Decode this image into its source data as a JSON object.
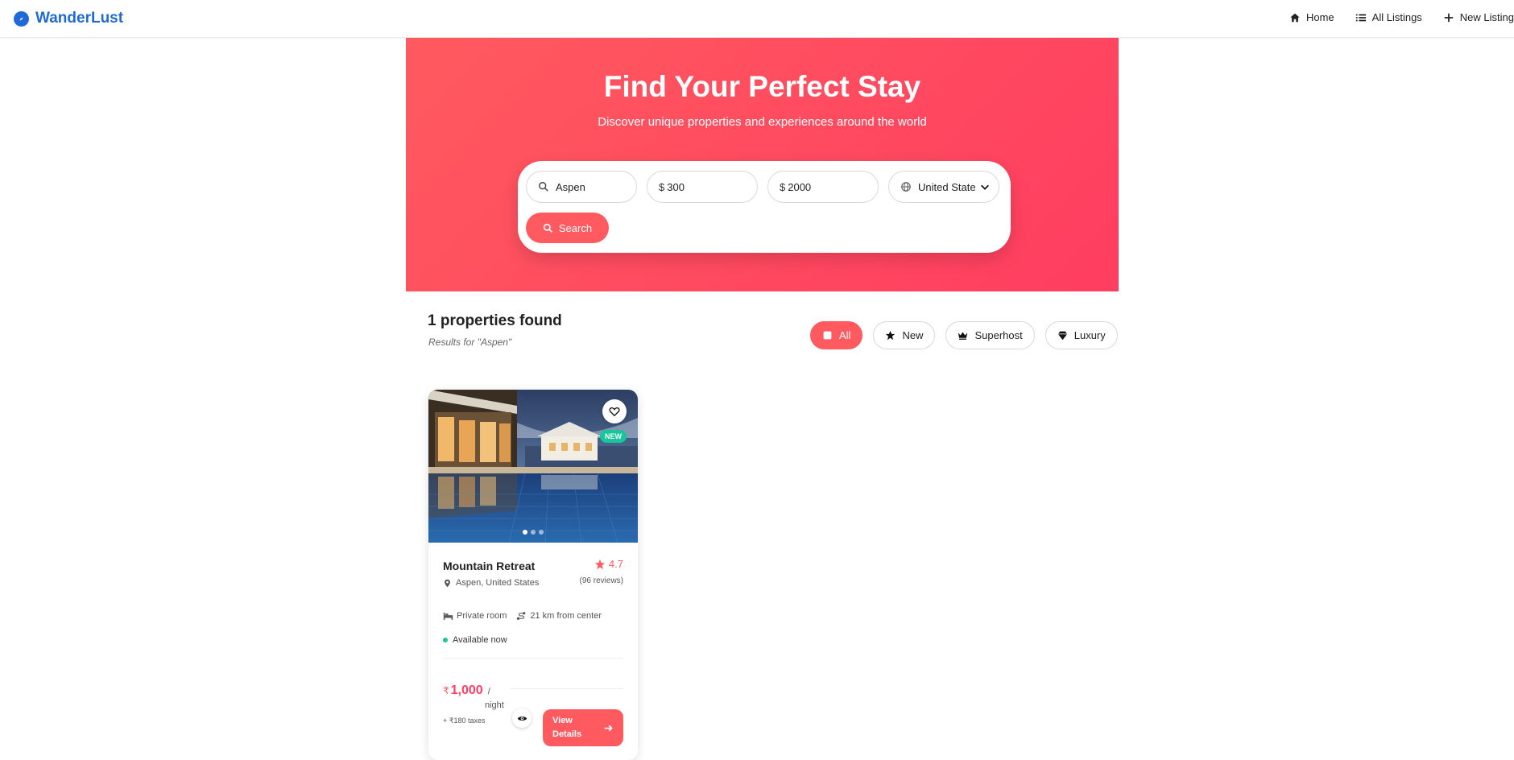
{
  "nav": {
    "brand": "WanderLust",
    "links": [
      {
        "label": "Home",
        "icon": "home-icon"
      },
      {
        "label": "All Listings",
        "icon": "list-icon"
      },
      {
        "label": "New Listing",
        "icon": "plus-icon"
      }
    ]
  },
  "hero": {
    "title": "Find Your Perfect Stay",
    "subtitle": "Discover unique properties and experiences around the world"
  },
  "search": {
    "location_value": "Aspen",
    "min_price_value": "300",
    "max_price_value": "2000",
    "currency_symbol": "$",
    "country_selected": "United State",
    "button_label": "Search"
  },
  "results": {
    "title": "1 properties found",
    "subtitle": "Results for \"Aspen\""
  },
  "filters": [
    {
      "label": "All",
      "icon": "grid-square-icon",
      "active": true
    },
    {
      "label": "New",
      "icon": "star-icon",
      "active": false
    },
    {
      "label": "Superhost",
      "icon": "crown-icon",
      "active": false
    },
    {
      "label": "Luxury",
      "icon": "diamond-icon",
      "active": false
    }
  ],
  "listing": {
    "title": "Mountain Retreat",
    "location": "Aspen, United States",
    "rating": "4.7",
    "reviews": "(96 reviews)",
    "badge": "NEW",
    "room_type": "Private room",
    "distance": "21 km from center",
    "availability": "Available now",
    "currency": "₹",
    "price": "1,000",
    "per": "/",
    "night": "night",
    "taxes": "+ ₹180 taxes",
    "view_button": "View Details"
  },
  "colors": {
    "brand": "#1f6ad8",
    "accent": "#ff5a5f",
    "accent_dark": "#ff3d60",
    "success": "#16c79a"
  }
}
